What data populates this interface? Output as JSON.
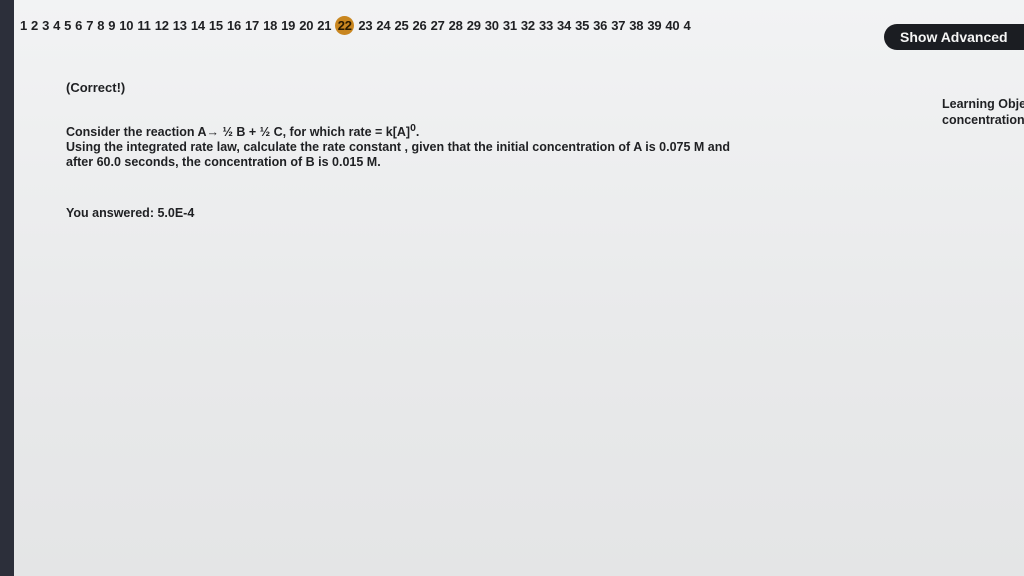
{
  "question_nav": {
    "numbers": [
      "1",
      "2",
      "3",
      "4",
      "5",
      "6",
      "7",
      "8",
      "9",
      "10",
      "11",
      "12",
      "13",
      "14",
      "15",
      "16",
      "17",
      "18",
      "19",
      "20",
      "21",
      "22",
      "23",
      "24",
      "25",
      "26",
      "27",
      "28",
      "29",
      "30",
      "31",
      "32",
      "33",
      "34",
      "35",
      "36",
      "37",
      "38",
      "39",
      "40",
      "4"
    ],
    "current": "22"
  },
  "toolbar": {
    "advanced_label": "Show Advanced"
  },
  "status": "(Correct!)",
  "question": {
    "line1_text": "Consider the reaction A",
    "arrow": "→",
    "line1_products": " ½ B + ½ C, for which rate = k[A]",
    "exponent": "0",
    "line1_end": ".",
    "line2": "Using the integrated rate law, calculate the rate constant , given that the initial concentration of A is 0.075 M and",
    "line3": "after 60.0 seconds, the concentration of B is 0.015 M."
  },
  "answer": {
    "label": "You answered: ",
    "value": "5.0E-4"
  },
  "learning_objective": {
    "title": "Learning Obje",
    "text": "concentration,"
  }
}
